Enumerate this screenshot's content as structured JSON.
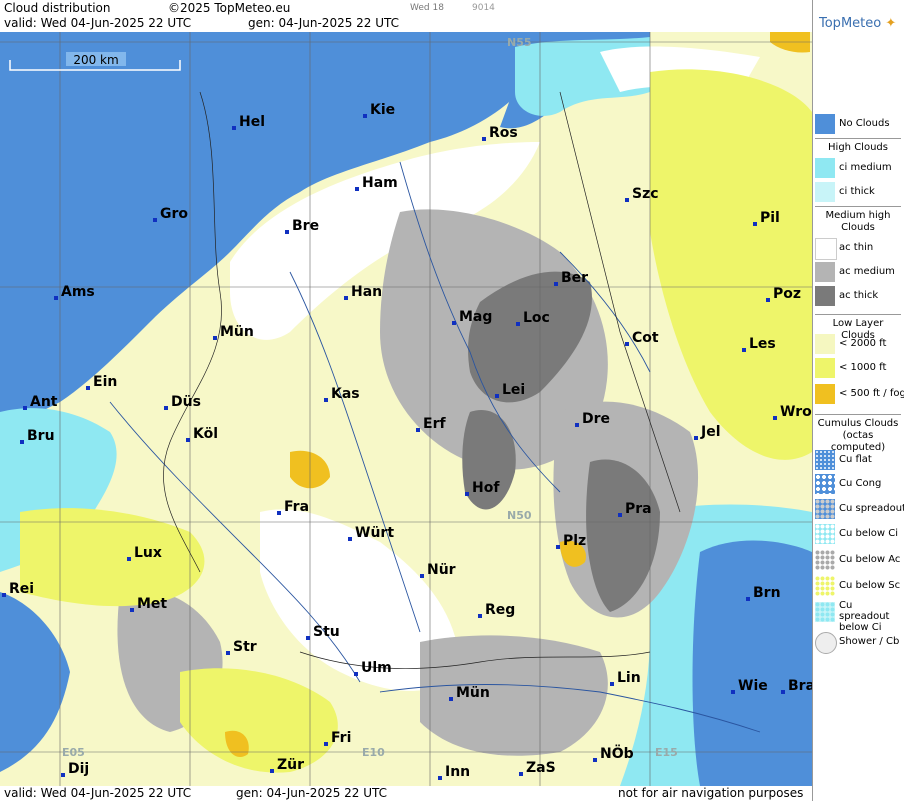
{
  "header": {
    "title": "Cloud distribution",
    "copyright": "©2025 TopMeteo.eu",
    "time_small": "Wed 18",
    "code_small": "9014",
    "valid": "valid:  Wed  04-Jun-2025  22 UTC",
    "gen": "gen: 04-Jun-2025  22 UTC"
  },
  "footer": {
    "valid": "valid:  Wed  04-Jun-2025  22 UTC",
    "gen": "gen: 04-Jun-2025  22 UTC",
    "note": "not for air navigation purposes"
  },
  "map": {
    "scale_label": "200 km",
    "grid_labels": {
      "n55": "N55",
      "n50": "N50",
      "e05": "E05",
      "e10": "E10",
      "e15": "E15"
    },
    "cities": [
      "Hel",
      "Kie",
      "Ros",
      "Ham",
      "Gro",
      "Bre",
      "Szc",
      "Pil",
      "Ams",
      "Han",
      "Ber",
      "Mag",
      "Loc",
      "Poz",
      "Mün",
      "Cot",
      "Les",
      "Ein",
      "Kas",
      "Lei",
      "Ant",
      "Düs",
      "Wro",
      "Bru",
      "Köl",
      "Erf",
      "Dre",
      "Jel",
      "Hof",
      "Fra",
      "Pra",
      "Würt",
      "Lux",
      "Plz",
      "Rei",
      "Nür",
      "Met",
      "Brn",
      "Reg",
      "Stu",
      "Str",
      "Lin",
      "Ulm",
      "Wie",
      "Bra",
      "Mün",
      "Fri",
      "Dij",
      "Zür",
      "Inn",
      "ZaS",
      "NÖb"
    ]
  },
  "legend": {
    "brand": "TopMeteo",
    "no_clouds": "No Clouds",
    "high_clouds": "High Clouds",
    "ci_medium": "ci medium",
    "ci_thick": "ci thick",
    "medium_high": "Medium high Clouds",
    "ac_thin": "ac thin",
    "ac_medium": "ac medium",
    "ac_thick": "ac thick",
    "low_layer": "Low Layer Clouds",
    "lt2000": "< 2000 ft",
    "lt1000": "< 1000 ft",
    "lt500": "< 500 ft / fog",
    "cumulus": "Cumulus Clouds (octas computed)",
    "cu_flat": "Cu flat",
    "cu_cong": "Cu Cong",
    "cu_spreadout": "Cu spreadout",
    "cu_below_ci": "Cu below Ci",
    "cu_below_ac": "Cu below Ac",
    "cu_below_sc": "Cu below Sc",
    "cu_spreadout_below_ci": "Cu spreadout below Ci",
    "shower_cb": "Shower / Cb"
  },
  "colors": {
    "sea": "#4a90e2",
    "no_clouds": "#4f8fd9",
    "ci_medium": "#8fe8f2",
    "ci_thick": "#c8f4f8",
    "ac_thin": "#ffffff",
    "ac_medium": "#b4b4b4",
    "ac_thick": "#7a7a7a",
    "low_2000": "#f5f7c0",
    "low_1000": "#eef56a",
    "low_500": "#f0c020"
  }
}
